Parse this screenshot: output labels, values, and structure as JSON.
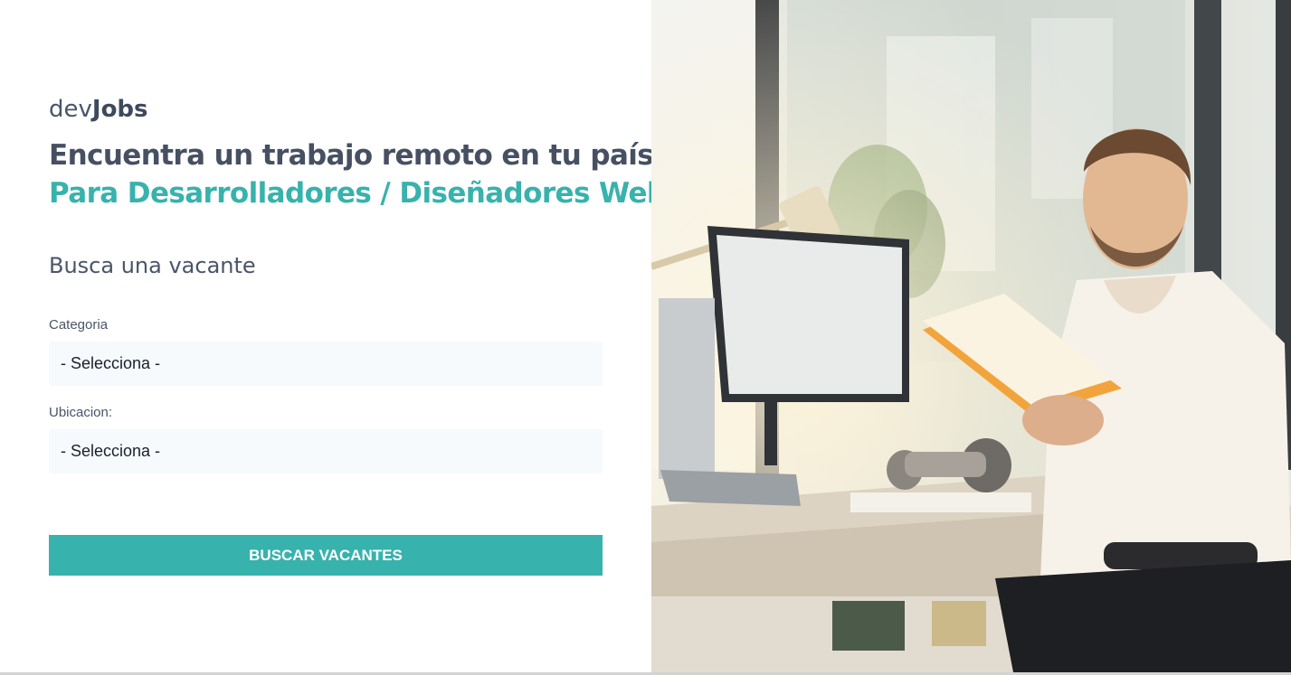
{
  "brand": {
    "prefix": "dev",
    "suffix": "Jobs"
  },
  "hero": {
    "title_line1": "Encuentra un trabajo remoto en tu país",
    "title_line2": "Para Desarrolladores / Diseñadores Web"
  },
  "search": {
    "heading": "Busca una vacante",
    "category_label": "Categoria",
    "category_value": "- Selecciona -",
    "location_label": "Ubicacion:",
    "location_value": "- Selecciona -",
    "submit_label": "BUSCAR VACANTES"
  },
  "colors": {
    "accent": "#38b2ac",
    "text": "#4a5568",
    "field_bg": "#f7fafc"
  },
  "image": {
    "subject": "man-reading-book-at-desk-photo"
  }
}
